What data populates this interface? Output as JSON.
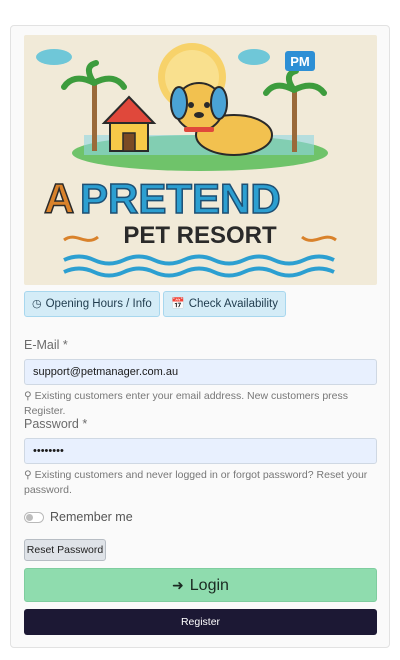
{
  "logo": {
    "badge": "PM",
    "line1_a": "A",
    "line1_b": "PRETEND",
    "line2": "PET RESORT"
  },
  "buttons": {
    "hours_label": "Opening Hours / Info",
    "availability_label": "Check Availability",
    "reset_label": "Reset Password",
    "login_label": "Login",
    "register_label": "Register"
  },
  "email": {
    "label": "E-Mail *",
    "value": "support@petmanager.com.au",
    "help": "Existing customers enter your email address. New customers press Register."
  },
  "password": {
    "label": "Password *",
    "value": "••••••••",
    "help": "Existing customers and never logged in or forgot password? Reset your password."
  },
  "remember": {
    "label": "Remember me",
    "checked": false
  },
  "icons": {
    "hours": "clock-icon",
    "availability": "calendar-icon",
    "help": "lightbulb-icon",
    "login": "sign-in-icon"
  },
  "colors": {
    "login_bg": "#8fdcae",
    "register_bg": "#1c1834",
    "info_btn_bg": "#d4ecf7",
    "input_bg": "#e8f0fe"
  }
}
